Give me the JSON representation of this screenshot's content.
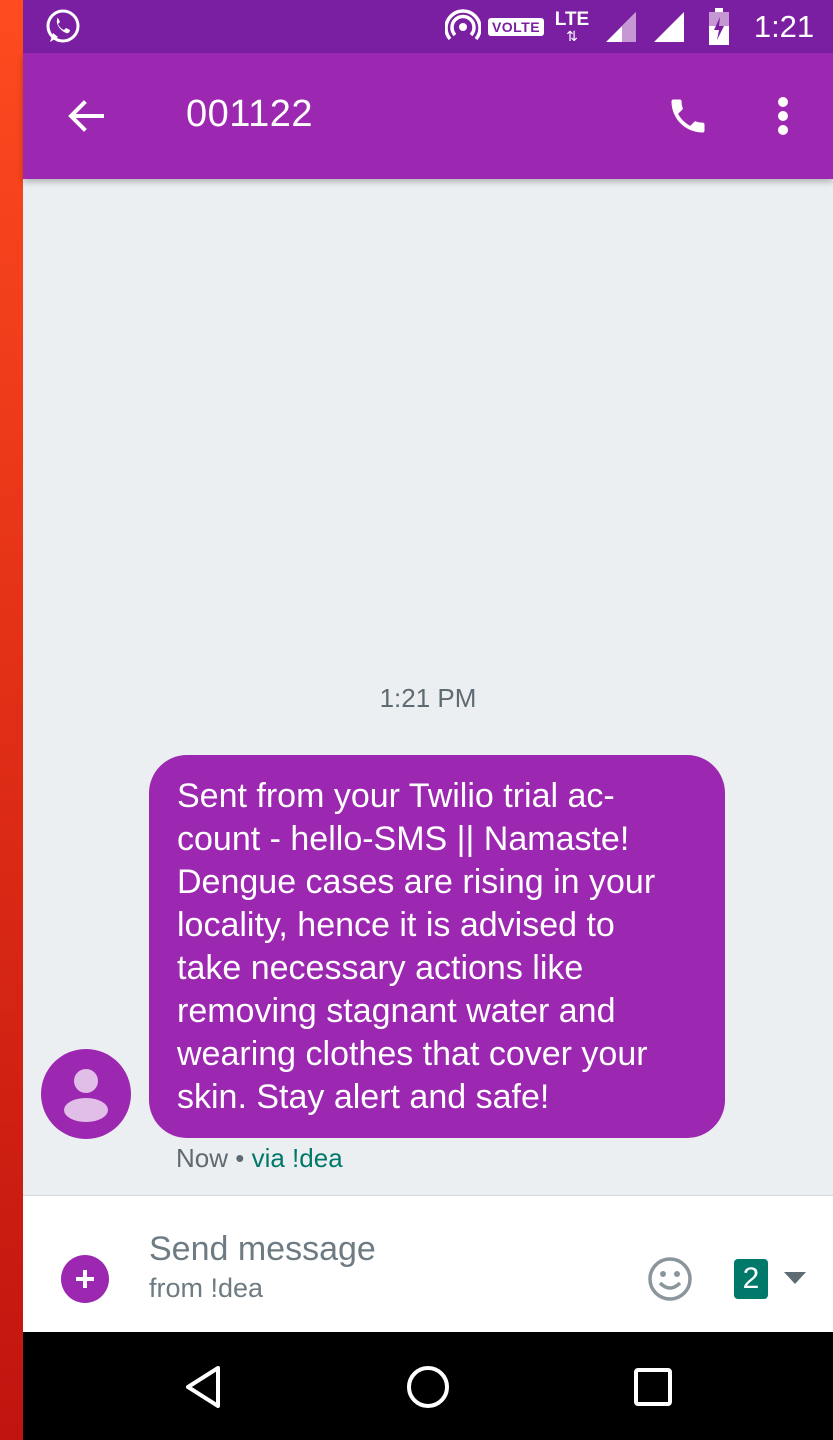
{
  "status_bar": {
    "network_badge": "VOLTE",
    "data_type": "LTE",
    "time": "1:21",
    "icons": [
      "whatsapp-notification-icon",
      "hotspot-icon",
      "signal-icon",
      "battery-charging-icon"
    ]
  },
  "toolbar": {
    "title": "001122",
    "back_icon": "arrow-back-icon",
    "call_icon": "phone-icon",
    "menu_icon": "more-vert-icon"
  },
  "conversation": {
    "timestamp": "1:21 PM",
    "message": {
      "text": "Sent from your Twilio trial ac-\ncount - hello-SMS  ||  Namaste!\nDengue cases are rising in your\nlocality, hence it is advised to\ntake necessary actions like\nremoving stagnant water and\nwearing clothes that cover your\nskin. Stay alert and safe!",
      "time": "Now",
      "separator": "•",
      "via": "via !dea"
    }
  },
  "compose": {
    "placeholder": "Send message",
    "subtext": "from !dea",
    "sim_number": "2",
    "colors": {
      "accent": "#9c27b0",
      "sim": "#00796b"
    }
  },
  "colors": {
    "status_bar": "#7b1fa2",
    "toolbar": "#9c27b0",
    "background": "#eceff1"
  }
}
